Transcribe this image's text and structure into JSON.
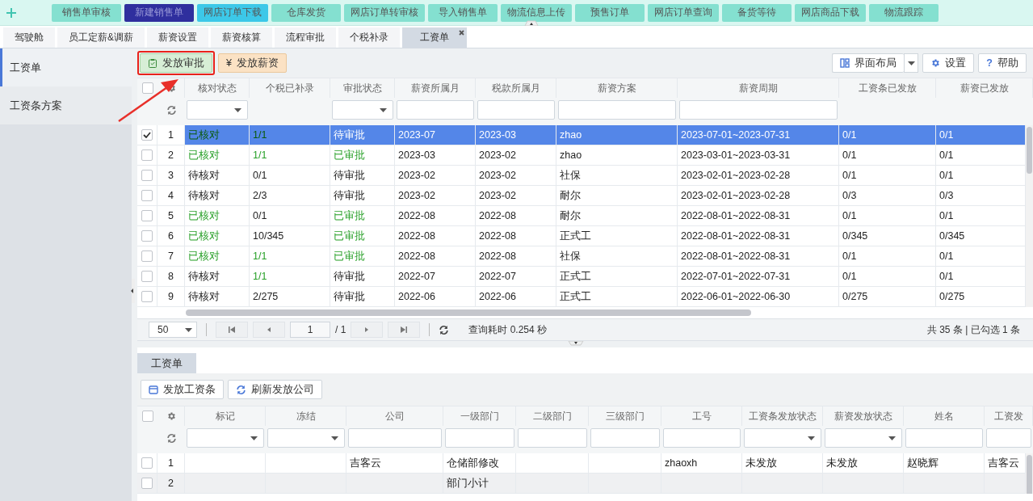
{
  "top_menu": [
    {
      "label": "销售单审核",
      "color": "#84e0d0"
    },
    {
      "label": "新建销售单",
      "color": "#2f2f9e"
    },
    {
      "label": "网店订单下载",
      "color": "#3cc8e8"
    },
    {
      "label": "仓库发货",
      "color": "#84e0d0"
    },
    {
      "label": "网店订单转审核",
      "color": "#84e0d0"
    },
    {
      "label": "导入销售单",
      "color": "#84e0d0"
    },
    {
      "label": "物流信息上传",
      "color": "#84e0d0"
    },
    {
      "label": "预售订单",
      "color": "#84e0d0"
    },
    {
      "label": "网店订单查询",
      "color": "#84e0d0"
    },
    {
      "label": "备货等待",
      "color": "#84e0d0"
    },
    {
      "label": "网店商品下载",
      "color": "#84e0d0"
    },
    {
      "label": "物流跟踪",
      "color": "#84e0d0"
    }
  ],
  "tabs": [
    {
      "label": "驾驶舱",
      "selected": false,
      "closable": false
    },
    {
      "label": "员工定薪&调薪",
      "selected": false,
      "closable": false
    },
    {
      "label": "薪资设置",
      "selected": false,
      "closable": false
    },
    {
      "label": "薪资核算",
      "selected": false,
      "closable": false
    },
    {
      "label": "流程审批",
      "selected": false,
      "closable": false
    },
    {
      "label": "个税补录",
      "selected": false,
      "closable": false
    },
    {
      "label": "工资单",
      "selected": true,
      "closable": true
    }
  ],
  "sidebar": {
    "items": [
      {
        "label": "工资单",
        "selected": true
      },
      {
        "label": "工资条方案",
        "selected": false
      }
    ]
  },
  "toolbar": {
    "buttons": [
      {
        "label": "发放审批",
        "kind": "approve",
        "highlighted": true
      },
      {
        "label": "发放薪资",
        "kind": "pay",
        "symbol": "¥",
        "highlighted": false
      }
    ],
    "right_buttons": [
      {
        "label": "界面布局",
        "kind": "layout"
      },
      {
        "label": "设置",
        "kind": "settings"
      },
      {
        "label": "帮助",
        "kind": "help",
        "symbol": "?"
      }
    ]
  },
  "table": {
    "select_all": false,
    "columns": [
      {
        "label": "核对状态",
        "kind": "select"
      },
      {
        "label": "个税已补录",
        "kind": "none"
      },
      {
        "label": "审批状态",
        "kind": "select"
      },
      {
        "label": "薪资所属月",
        "kind": "text"
      },
      {
        "label": "税款所属月",
        "kind": "text"
      },
      {
        "label": "薪资方案",
        "kind": "text"
      },
      {
        "label": "薪资周期",
        "kind": "text"
      },
      {
        "label": "工资条已发放",
        "kind": "none"
      },
      {
        "label": "薪资已发放",
        "kind": "none"
      }
    ],
    "rows": [
      {
        "no": "1",
        "selected": true,
        "checked": true,
        "verified": true,
        "tax_done": true,
        "approved": false,
        "cells": [
          "已核对",
          "1/1",
          "待审批",
          "2023-07",
          "2023-03",
          "zhao",
          "2023-07-01~2023-07-31",
          "0/1",
          "0/1"
        ]
      },
      {
        "no": "2",
        "selected": false,
        "checked": false,
        "verified": true,
        "tax_done": true,
        "approved": true,
        "cells": [
          "已核对",
          "1/1",
          "已审批",
          "2023-03",
          "2023-02",
          "zhao",
          "2023-03-01~2023-03-31",
          "0/1",
          "0/1"
        ]
      },
      {
        "no": "3",
        "selected": false,
        "checked": false,
        "verified": false,
        "tax_done": false,
        "approved": false,
        "cells": [
          "待核对",
          "0/1",
          "待审批",
          "2023-02",
          "2023-02",
          "社保",
          "2023-02-01~2023-02-28",
          "0/1",
          "0/1"
        ]
      },
      {
        "no": "4",
        "selected": false,
        "checked": false,
        "verified": false,
        "tax_done": false,
        "approved": false,
        "cells": [
          "待核对",
          "2/3",
          "待审批",
          "2023-02",
          "2023-02",
          "耐尔",
          "2023-02-01~2023-02-28",
          "0/3",
          "0/3"
        ]
      },
      {
        "no": "5",
        "selected": false,
        "checked": false,
        "verified": true,
        "tax_done": false,
        "approved": true,
        "cells": [
          "已核对",
          "0/1",
          "已审批",
          "2022-08",
          "2022-08",
          "耐尔",
          "2022-08-01~2022-08-31",
          "0/1",
          "0/1"
        ]
      },
      {
        "no": "6",
        "selected": false,
        "checked": false,
        "verified": true,
        "tax_done": false,
        "approved": true,
        "cells": [
          "已核对",
          "10/345",
          "已审批",
          "2022-08",
          "2022-08",
          "正式工",
          "2022-08-01~2022-08-31",
          "0/345",
          "0/345"
        ]
      },
      {
        "no": "7",
        "selected": false,
        "checked": false,
        "verified": true,
        "tax_done": true,
        "approved": true,
        "cells": [
          "已核对",
          "1/1",
          "已审批",
          "2022-08",
          "2022-08",
          "社保",
          "2022-08-01~2022-08-31",
          "0/1",
          "0/1"
        ]
      },
      {
        "no": "8",
        "selected": false,
        "checked": false,
        "verified": false,
        "tax_done": true,
        "approved": false,
        "cells": [
          "待核对",
          "1/1",
          "待审批",
          "2022-07",
          "2022-07",
          "正式工",
          "2022-07-01~2022-07-31",
          "0/1",
          "0/1"
        ]
      },
      {
        "no": "9",
        "selected": false,
        "checked": false,
        "verified": false,
        "tax_done": false,
        "approved": false,
        "cells": [
          "待核对",
          "2/275",
          "待审批",
          "2022-06",
          "2022-06",
          "正式工",
          "2022-06-01~2022-06-30",
          "0/275",
          "0/275"
        ]
      }
    ]
  },
  "pager": {
    "page_size": "50",
    "page": "1",
    "page_total": "/ 1",
    "query_time": "查询耗时 0.254 秒",
    "summary": "共 35 条 | 已勾选 1 条"
  },
  "detail": {
    "tabs": [
      {
        "label": "工资单",
        "selected": true
      }
    ],
    "buttons": [
      {
        "label": "发放工资条",
        "kind": "payslip"
      },
      {
        "label": "刷新发放公司",
        "kind": "refresh"
      }
    ],
    "table": {
      "select_all": false,
      "columns": [
        {
          "label": "标记",
          "kind": "select"
        },
        {
          "label": "冻结",
          "kind": "select"
        },
        {
          "label": "公司",
          "kind": "text"
        },
        {
          "label": "一级部门",
          "kind": "text"
        },
        {
          "label": "二级部门",
          "kind": "text"
        },
        {
          "label": "三级部门",
          "kind": "text"
        },
        {
          "label": "工号",
          "kind": "text"
        },
        {
          "label": "工资条发放状态",
          "kind": "select"
        },
        {
          "label": "薪资发放状态",
          "kind": "select"
        },
        {
          "label": "姓名",
          "kind": "text"
        },
        {
          "label": "工资发",
          "kind": "text"
        }
      ],
      "rows": [
        {
          "no": "1",
          "checked": false,
          "kind": "detail",
          "cells": [
            null,
            null,
            "吉客云",
            "仓储部修改",
            null,
            null,
            "zhaoxh",
            "未发放",
            "未发放",
            "赵晓辉",
            "吉客云"
          ]
        },
        {
          "no": "2",
          "checked": false,
          "kind": "subtotal",
          "cells": [
            null,
            null,
            null,
            "部门小计",
            null,
            null,
            null,
            null,
            null,
            null,
            null
          ]
        }
      ]
    }
  }
}
